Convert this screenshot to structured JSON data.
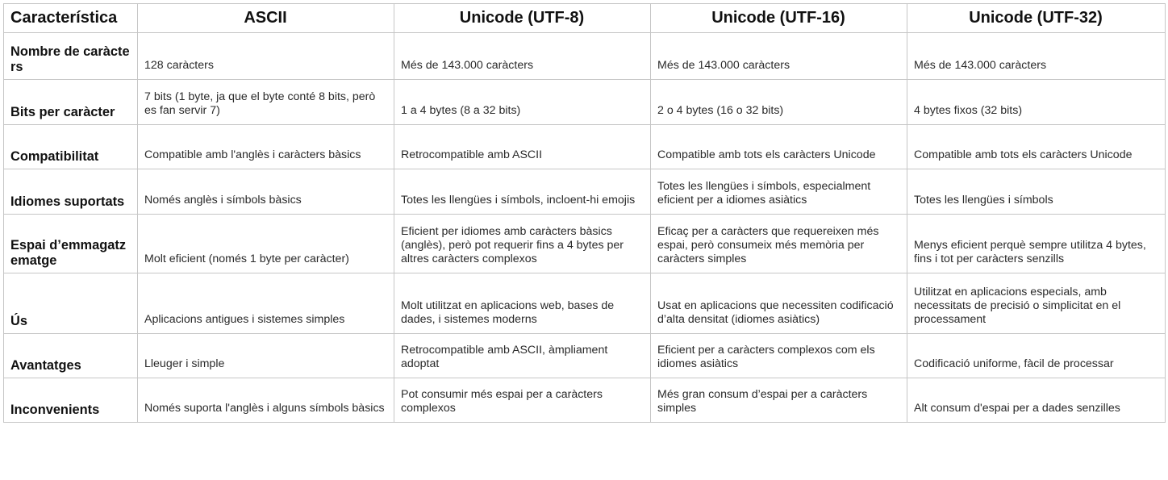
{
  "headers": [
    "Característica",
    "ASCII",
    "Unicode (UTF-8)",
    "Unicode (UTF-16)",
    "Unicode (UTF-32)"
  ],
  "rows": [
    {
      "label": "Nombre de caràcters",
      "cells": [
        "128 caràcters",
        "Més de 143.000 caràcters",
        "Més de 143.000 caràcters",
        "Més de 143.000 caràcters"
      ]
    },
    {
      "label": "Bits per caràcter",
      "cells": [
        "7 bits (1 byte, ja que el byte conté 8 bits, però es fan servir 7)",
        "1 a 4 bytes (8 a 32 bits)",
        "2 o 4 bytes (16 o 32 bits)",
        "4 bytes fixos (32 bits)"
      ]
    },
    {
      "label": "Compatibilitat",
      "cells": [
        "Compatible amb l'anglès i caràcters bàsics",
        "Retrocompatible amb ASCII",
        "Compatible amb tots els caràcters Unicode",
        "Compatible amb tots els caràcters Unicode"
      ]
    },
    {
      "label": "Idiomes suportats",
      "cells": [
        "Només anglès i símbols bàsics",
        "Totes les llengües i símbols, incloent-hi emojis",
        "Totes les llengües i símbols, especialment eficient per a idiomes asiàtics",
        "Totes les llengües i símbols"
      ]
    },
    {
      "label": "Espai d’emmagatzematge",
      "cells": [
        "Molt eficient (només 1 byte per caràcter)",
        "Eficient per idiomes amb caràcters bàsics (anglès), però pot requerir fins a 4 bytes per altres caràcters complexos",
        "Eficaç per a caràcters que requereixen més espai, però consumeix més memòria per caràcters simples",
        "Menys eficient perquè sempre utilitza 4 bytes, fins i tot per caràcters senzills"
      ]
    },
    {
      "label": "Ús",
      "cells": [
        "Aplicacions antigues i sistemes simples",
        "Molt utilitzat en aplicacions web, bases de dades, i sistemes moderns",
        "Usat en aplicacions que necessiten codificació d’alta densitat (idiomes asiàtics)",
        "Utilitzat en aplicacions especials, amb necessitats de precisió o simplicitat en el processament"
      ]
    },
    {
      "label": "Avantatges",
      "cells": [
        "Lleuger i simple",
        "Retrocompatible amb ASCII, àmpliament adoptat",
        "Eficient per a caràcters complexos com els idiomes asiàtics",
        "Codificació uniforme, fàcil de processar"
      ]
    },
    {
      "label": "Inconvenients",
      "cells": [
        "Només suporta l'anglès i alguns símbols bàsics",
        "Pot consumir més espai per a caràcters complexos",
        "Més gran consum d’espai per a caràcters simples",
        "Alt consum d'espai per a dades senzilles"
      ]
    }
  ]
}
